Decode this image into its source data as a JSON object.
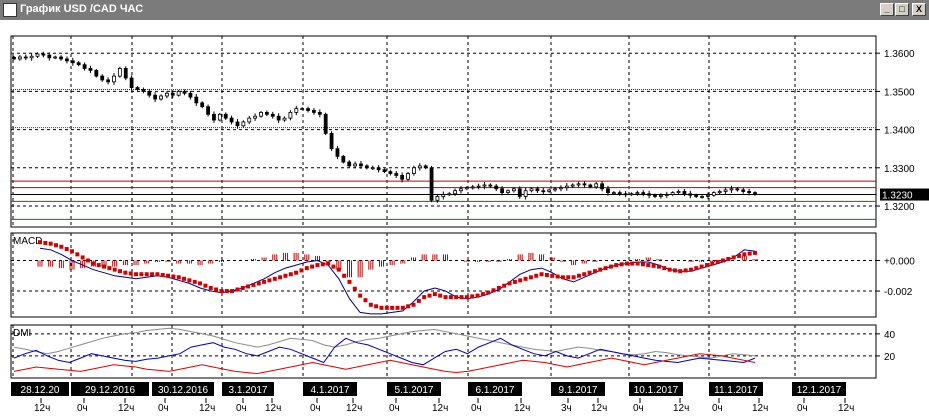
{
  "window": {
    "title": "График USD /CAD ЧАС",
    "buttons": [
      "_",
      "□",
      "X"
    ]
  },
  "chart_data": [
    {
      "type": "candlestick",
      "name": "",
      "y_ticks": [
        "1.3600",
        "1.3500",
        "1.3400",
        "1.3300",
        "1.3200"
      ],
      "y_tick_values": [
        1.36,
        1.35,
        1.34,
        1.33,
        1.32
      ],
      "ylim": [
        1.3145,
        1.3645
      ],
      "current_price_label": "1.3230",
      "current_price": 1.323,
      "horizontal_levels": [
        {
          "value": 1.3505,
          "color": "#c00000",
          "style": "dotted"
        },
        {
          "value": 1.3405,
          "color": "#c00000",
          "style": "dotted"
        },
        {
          "value": 1.3265,
          "color": "#c00000",
          "style": "solid"
        },
        {
          "value": 1.3248,
          "color": "#c00000",
          "style": "solid"
        },
        {
          "value": 1.323,
          "color": "#000000",
          "style": "solid"
        },
        {
          "value": 1.3212,
          "color": "#008000",
          "style": "solid"
        },
        {
          "value": 1.3165,
          "color": "#008000",
          "style": "solid"
        }
      ],
      "close_path": [
        1.3585,
        1.359,
        1.3588,
        1.3592,
        1.3598,
        1.3595,
        1.3588,
        1.359,
        1.3585,
        1.358,
        1.3575,
        1.357,
        1.356,
        1.3555,
        1.354,
        1.353,
        1.3525,
        1.354,
        1.356,
        1.3535,
        1.351,
        1.3505,
        1.35,
        1.349,
        1.348,
        1.3488,
        1.3495,
        1.349,
        1.35,
        1.3495,
        1.3485,
        1.347,
        1.346,
        1.344,
        1.3425,
        1.344,
        1.343,
        1.342,
        1.341,
        1.342,
        1.343,
        1.3435,
        1.3445,
        1.344,
        1.3435,
        1.3425,
        1.343,
        1.3445,
        1.3455,
        1.3455,
        1.345,
        1.3445,
        1.344,
        1.339,
        1.335,
        1.333,
        1.3315,
        1.3305,
        1.331,
        1.3305,
        1.33,
        1.33,
        1.3295,
        1.329,
        1.3285,
        1.328,
        1.327,
        1.3285,
        1.33,
        1.3305,
        1.33,
        1.3215,
        1.3225,
        1.323,
        1.3232,
        1.324,
        1.3245,
        1.3248,
        1.325,
        1.3252,
        1.3255,
        1.3252,
        1.3245,
        1.3235,
        1.324,
        1.3245,
        1.3225,
        1.324,
        1.3245,
        1.324,
        1.3238,
        1.3242,
        1.3245,
        1.3248,
        1.3252,
        1.3255,
        1.3258,
        1.3255,
        1.325,
        1.3258,
        1.3245,
        1.3235,
        1.3235,
        1.3232,
        1.323,
        1.3232,
        1.3235,
        1.3232,
        1.3228,
        1.3225,
        1.3228,
        1.323,
        1.3235,
        1.3238,
        1.3232,
        1.3228,
        1.3225,
        1.3225,
        1.3228,
        1.3235,
        1.3238,
        1.3242,
        1.3245,
        1.3242,
        1.3238,
        1.3235,
        1.323
      ]
    },
    {
      "type": "line",
      "name": "MACD",
      "y_ticks": [
        "+0.000",
        "-0.002"
      ],
      "y_tick_values": [
        0.0,
        -0.002
      ],
      "ylim": [
        -0.0037,
        0.0018
      ],
      "macd": [
        0.0008,
        0.0007,
        0.0004,
        0.0,
        -0.0003,
        -0.0006,
        -0.0008,
        -0.001,
        -0.0011,
        -0.0012,
        -0.0011,
        -0.001,
        -0.0011,
        -0.0013,
        -0.0015,
        -0.0018,
        -0.002,
        -0.0021,
        -0.002,
        -0.0018,
        -0.0015,
        -0.0012,
        -0.0008,
        -0.0005,
        -0.0003,
        -0.0001,
        0.0,
        -0.0003,
        -0.0012,
        -0.0025,
        -0.0034,
        -0.0035,
        -0.0035,
        -0.0034,
        -0.0033,
        -0.0027,
        -0.002,
        -0.0018,
        -0.002,
        -0.0024,
        -0.0025,
        -0.0024,
        -0.0022,
        -0.0019,
        -0.0014,
        -0.0009,
        -0.0006,
        -0.0005,
        -0.0008,
        -0.0012,
        -0.0014,
        -0.0011,
        -0.0008,
        -0.0005,
        -0.0003,
        -0.0002,
        -0.0001,
        -0.0001,
        -0.0003,
        -0.0006,
        -0.0007,
        -0.0007,
        -0.0005,
        -0.0003,
        -0.0001,
        0.0002,
        0.0007,
        0.0006
      ],
      "signal": [
        0.0012,
        0.0011,
        0.0009,
        0.0006,
        0.0002,
        -0.0002,
        -0.0004,
        -0.0006,
        -0.0008,
        -0.0009,
        -0.0009,
        -0.0009,
        -0.001,
        -0.0011,
        -0.0013,
        -0.0015,
        -0.0018,
        -0.002,
        -0.002,
        -0.0018,
        -0.0016,
        -0.0014,
        -0.0012,
        -0.001,
        -0.0008,
        -0.0005,
        -0.0003,
        -0.0002,
        -0.0006,
        -0.0014,
        -0.0023,
        -0.0029,
        -0.0031,
        -0.0031,
        -0.0031,
        -0.0029,
        -0.0024,
        -0.0022,
        -0.0024,
        -0.0024,
        -0.0024,
        -0.0023,
        -0.0021,
        -0.0018,
        -0.0015,
        -0.0013,
        -0.0011,
        -0.0009,
        -0.001,
        -0.0011,
        -0.0011,
        -0.0009,
        -0.0007,
        -0.0005,
        -0.0003,
        -0.0002,
        -0.0002,
        -0.0003,
        -0.0004,
        -0.0006,
        -0.0007,
        -0.0006,
        -0.0004,
        -0.0002,
        0.0,
        0.0002,
        0.0004,
        0.0005
      ]
    },
    {
      "type": "line",
      "name": "DMI",
      "y_ticks": [
        "40",
        "20"
      ],
      "y_tick_values": [
        40,
        20
      ],
      "ylim": [
        0,
        48
      ],
      "adx": [
        28,
        26,
        24,
        22,
        24,
        27,
        30,
        33,
        36,
        38,
        40,
        41,
        43,
        44,
        45,
        44,
        42,
        40,
        38,
        35,
        32,
        30,
        28,
        30,
        33,
        36,
        35,
        34,
        30,
        28,
        30,
        33,
        35,
        36,
        38,
        40,
        42,
        43,
        44,
        42,
        40,
        38,
        36,
        34,
        32,
        30,
        28,
        26,
        25,
        24,
        26,
        28,
        27,
        25,
        24,
        22,
        21,
        22,
        24,
        23,
        21,
        20,
        19,
        18,
        20,
        22,
        21,
        20
      ],
      "plus_di": [
        18,
        22,
        25,
        20,
        16,
        14,
        18,
        22,
        20,
        18,
        16,
        15,
        17,
        18,
        20,
        22,
        28,
        30,
        32,
        28,
        26,
        22,
        20,
        24,
        28,
        26,
        22,
        18,
        14,
        28,
        36,
        32,
        30,
        26,
        22,
        18,
        14,
        12,
        18,
        24,
        26,
        22,
        28,
        32,
        36,
        30,
        26,
        22,
        20,
        24,
        20,
        18,
        22,
        26,
        24,
        22,
        20,
        18,
        16,
        15,
        14,
        16,
        18,
        17,
        16,
        15,
        14,
        18
      ],
      "minus_di": [
        6,
        8,
        10,
        9,
        8,
        7,
        6,
        8,
        10,
        12,
        11,
        10,
        8,
        7,
        6,
        8,
        10,
        12,
        10,
        8,
        6,
        5,
        4,
        6,
        8,
        10,
        12,
        14,
        12,
        10,
        8,
        10,
        12,
        14,
        16,
        14,
        12,
        10,
        8,
        6,
        5,
        6,
        8,
        10,
        12,
        14,
        16,
        15,
        14,
        12,
        10,
        12,
        14,
        16,
        18,
        16,
        14,
        12,
        14,
        16,
        18,
        20,
        22,
        21,
        20,
        18,
        16,
        14
      ]
    }
  ],
  "time_axis": {
    "dates": [
      "28.12.20",
      "29.12.2016",
      "30.12.2016",
      "3.1.2017",
      "4.1.2017",
      "5.1.2017",
      "6.1.2017",
      "9.1.2017",
      "10.1.2017",
      "11.1.2017",
      "12.1.2017"
    ],
    "hours": [
      "12ч",
      "0ч",
      "12ч",
      "0ч",
      "12ч",
      "0ч",
      "12ч",
      "0ч",
      "12ч",
      "0ч",
      "12ч",
      "0ч",
      "12ч",
      "3ч",
      "12ч",
      "0ч",
      "12ч",
      "0ч",
      "12ч",
      "0ч",
      "12ч"
    ]
  }
}
